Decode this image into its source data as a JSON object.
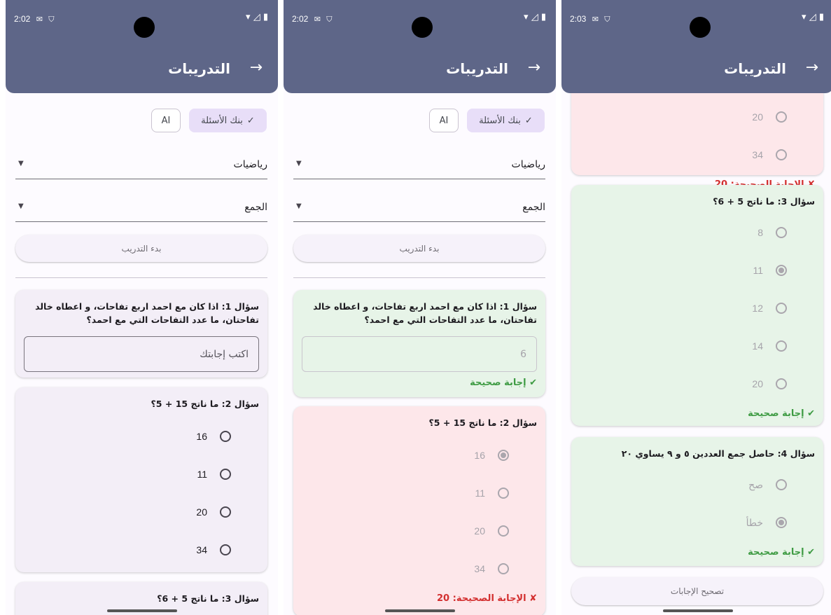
{
  "status_times": [
    "2:02",
    "2:02",
    "2:03"
  ],
  "appbar": {
    "title": "التدريبات",
    "back_glyph": "→"
  },
  "filters": {
    "chip_ai": "AI",
    "chip_bank": "بنك الأسئلة",
    "subject": "رياضيات",
    "topic": "الجمع",
    "start_button": "بدء التدريب"
  },
  "questions": {
    "q1": {
      "text": "سؤال 1: اذا كان مع احمد اربع تفاحات، و اعطاه خالد تفاحتان، ما عدد التفاحات التي مع احمد؟",
      "placeholder": "اكتب إجابتك",
      "answer": "6"
    },
    "q2": {
      "text": "سؤال 2: ما ناتج 15 + 5؟",
      "options": [
        "16",
        "11",
        "20",
        "34"
      ]
    },
    "q3": {
      "text": "سؤال 3: ما ناتج 5 + 6؟",
      "options": [
        "8",
        "11",
        "12",
        "14",
        "20"
      ]
    },
    "q4": {
      "text": "سؤال 4: حاصل جمع العددين ٥ و ٩ يساوي ٢٠",
      "options": [
        "صح",
        "خطأ"
      ]
    },
    "q2_partial_options": [
      "20",
      "34"
    ]
  },
  "feedback": {
    "correct": "✔ إجابة صحيحة",
    "wrong": "✘ الإجابة الصحيحة: 20"
  },
  "correct_answers_button": "تصحيح الإجابات",
  "colors": {
    "appbar": "#5e6688",
    "correct_bg": "#e7f4e8",
    "wrong_bg": "#fde7ea",
    "neutral_bg": "#f3eef7"
  }
}
